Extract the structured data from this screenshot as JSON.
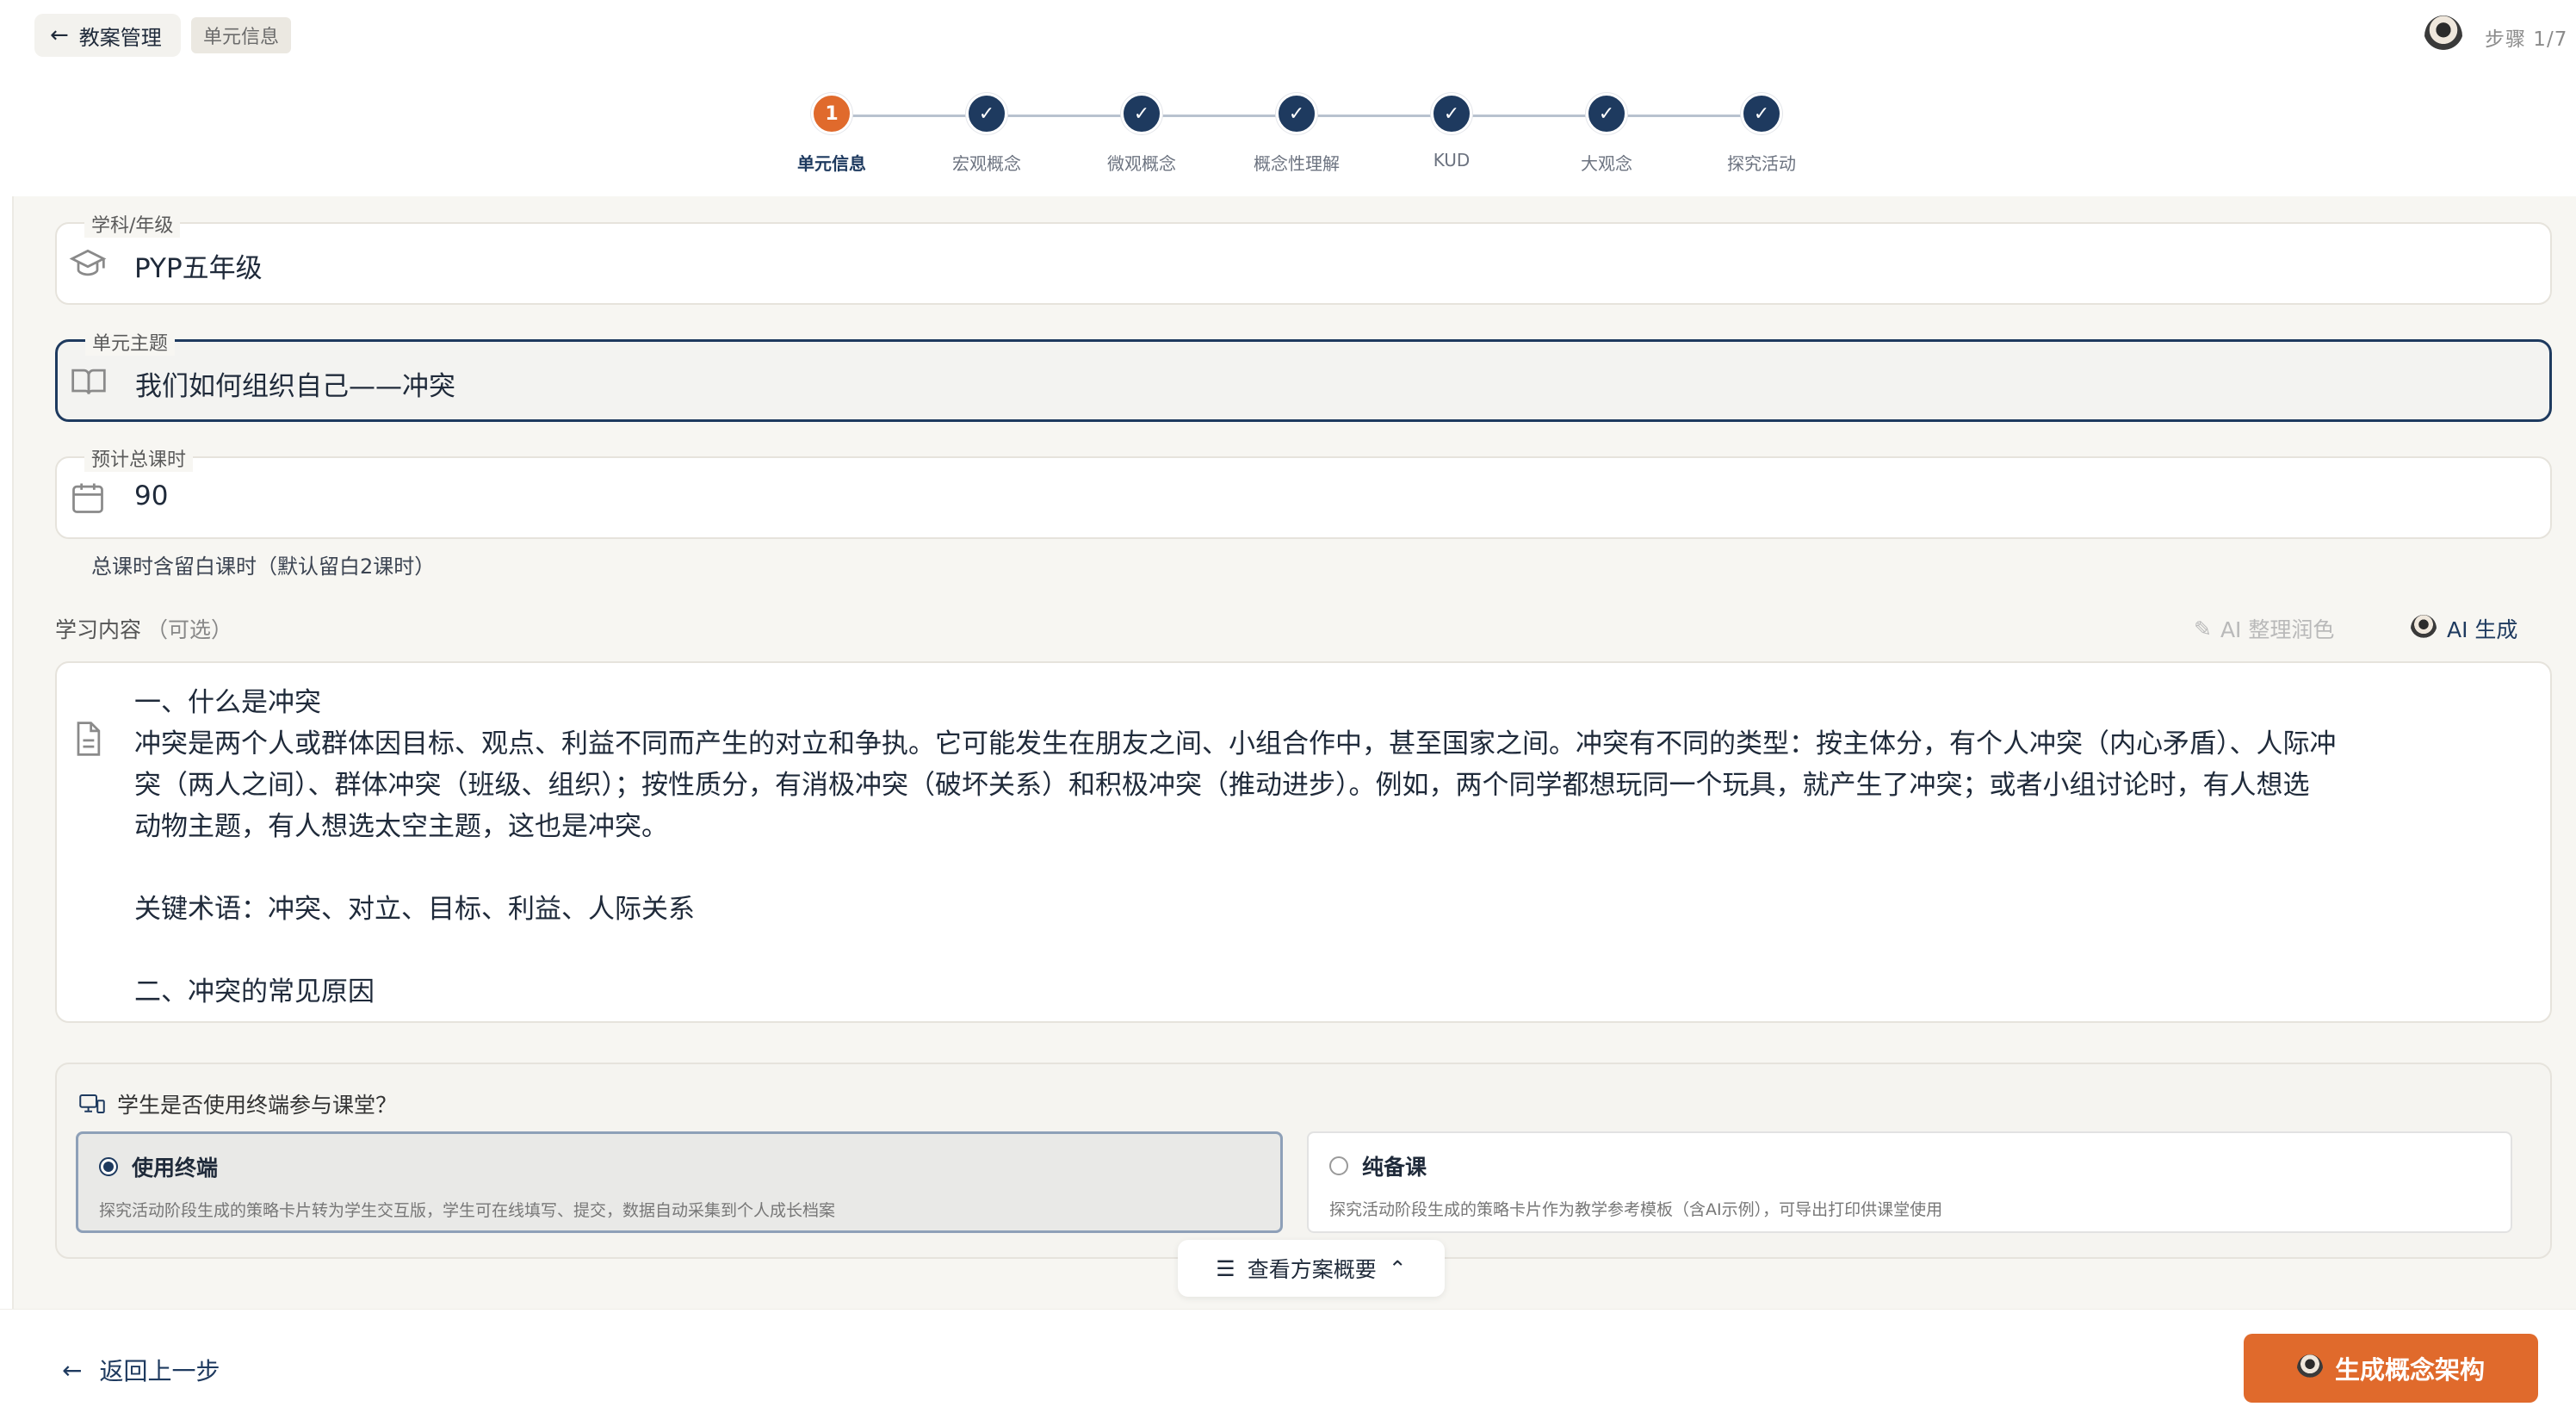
{
  "header": {
    "back_label": "教案管理",
    "crumb": "单元信息",
    "step_counter": "步骤 1/7"
  },
  "stepper": {
    "steps": [
      {
        "label": "单元信息",
        "number": "1",
        "state": "active"
      },
      {
        "label": "宏观概念",
        "state": "done"
      },
      {
        "label": "微观概念",
        "state": "done"
      },
      {
        "label": "概念性理解",
        "state": "done"
      },
      {
        "label": "KUD",
        "state": "done"
      },
      {
        "label": "大观念",
        "state": "done"
      },
      {
        "label": "探究活动",
        "state": "done"
      }
    ]
  },
  "form": {
    "subject": {
      "label": "学科/年级",
      "value": "PYP五年级",
      "icon": "graduation-cap-icon"
    },
    "theme": {
      "label": "单元主题",
      "value": "我们如何组织自己——冲突",
      "icon": "book-open-icon"
    },
    "hours": {
      "label": "预计总课时",
      "value": "90",
      "icon": "calendar-icon"
    },
    "hours_hint": "总课时含留白课时（默认留白2课时）"
  },
  "learning": {
    "label": "学习内容",
    "optional": "（可选）",
    "polish_label": "AI 整理润色",
    "generate_label": "AI 生成",
    "lines": [
      "一、什么是冲突",
      "冲突是两个人或群体因目标、观点、利益不同而产生的对立和争执。它可能发生在朋友之间、小组合作中，甚至国家之间。冲突有不同的类型：按主体分，有个人冲突（内心矛盾）、人际冲",
      "突（两人之间）、群体冲突（班级、组织）；按性质分，有消极冲突（破坏关系）和积极冲突（推动进步）。例如，两个同学都想玩同一个玩具，就产生了冲突；或者小组讨论时，有人想选",
      "动物主题，有人想选太空主题，这也是冲突。",
      "",
      "关键术语：冲突、对立、目标、利益、人际关系",
      "",
      "二、冲突的常见原因"
    ]
  },
  "terminal": {
    "question": "学生是否使用终端参与课堂？",
    "options": [
      {
        "title": "使用终端",
        "desc": "探究活动阶段生成的策略卡片转为学生交互版，学生可在线填写、提交，数据自动采集到个人成长档案",
        "selected": true
      },
      {
        "title": "纯备课",
        "desc": "探究活动阶段生成的策略卡片作为教学参考模板（含AI示例），可导出打印供课堂使用",
        "selected": false
      }
    ]
  },
  "overview_label": "查看方案概要",
  "footer": {
    "prev_label": "返回上一步",
    "generate_label": "生成概念架构"
  },
  "colors": {
    "accent": "#e06a2c",
    "primary": "#1e3a5f",
    "background": "#f7f6f2"
  }
}
